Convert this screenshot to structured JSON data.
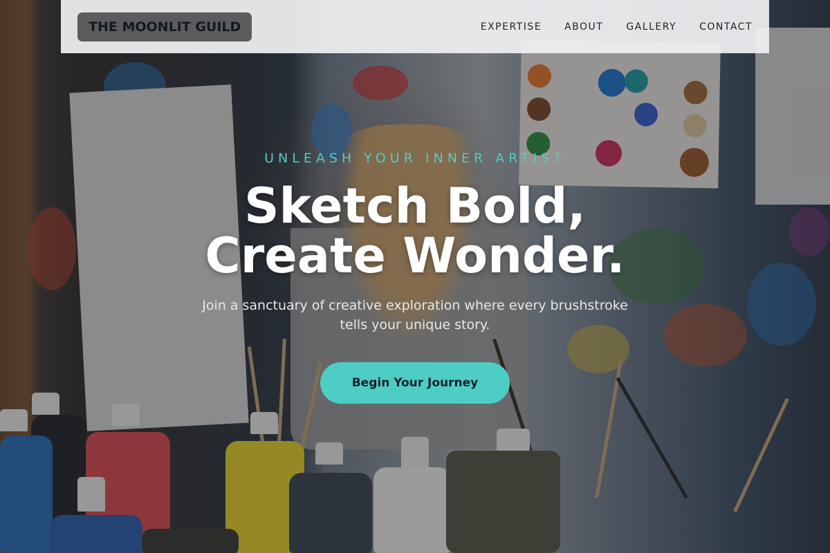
{
  "header": {
    "brand": "THE MOONLIT GUILD",
    "nav": [
      {
        "label": "EXPERTISE"
      },
      {
        "label": "ABOUT"
      },
      {
        "label": "GALLERY"
      },
      {
        "label": "CONTACT"
      }
    ]
  },
  "hero": {
    "eyebrow": "UNLEASH YOUR INNER ARTIST",
    "headline_line1": "Sketch Bold,",
    "headline_line2": "Create Wonder.",
    "subtext_line1": "Join a sanctuary of creative exploration where every brushstroke",
    "subtext_line2": "tells your unique story.",
    "cta_label": "Begin Your Journey"
  },
  "colors": {
    "accent": "#4ecdc4",
    "header_bg": "#f0f0f2",
    "brand_bg": "#5c5c5f"
  }
}
